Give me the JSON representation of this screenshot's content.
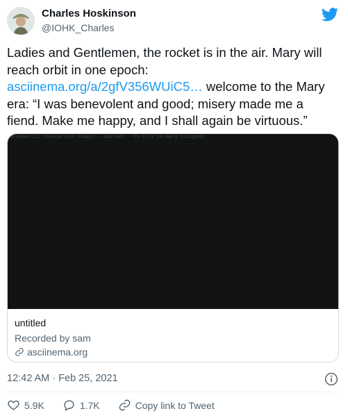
{
  "author": {
    "name": "Charles Hoskinson",
    "handle": "@IOHK_Charles"
  },
  "tweet": {
    "text_before_link": "Ladies and Gentlemen, the rocket is in the air. Mary will reach orbit in one epoch: ",
    "link": "asciinema.org/a/2gfV356WUiC5…",
    "text_after_link": " welcome to the Mary era: “I was benevolent and good; misery made me a fiend. Make me happy, and I shall again be virtuous.”"
  },
  "card": {
    "terminal_snippet": "cardano-cli transaction submit --mainnet   --tx-file tx-mary.txsigned",
    "title": "untitled",
    "subtitle": "Recorded by sam",
    "domain": "asciinema.org"
  },
  "timestamp": "12:42 AM · Feb 25, 2021",
  "actions": {
    "likes": "5.9K",
    "replies": "1.7K",
    "copy_link": "Copy link to Tweet"
  },
  "colors": {
    "link": "#1d9bf0",
    "twitter_blue": "#1d9bf0",
    "secondary_text": "#536471",
    "media_background": "#121314"
  }
}
